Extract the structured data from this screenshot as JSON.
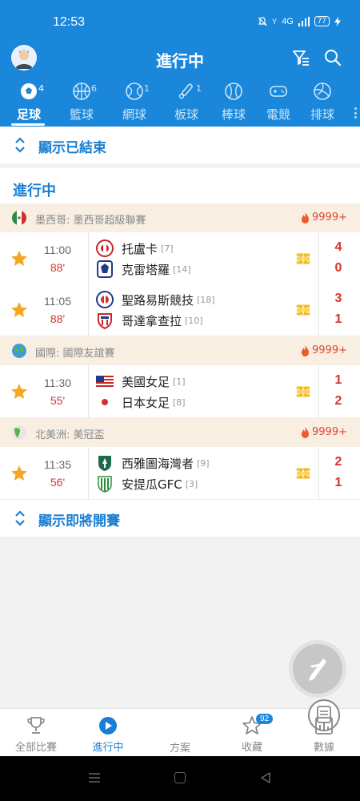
{
  "status": {
    "time": "12:53",
    "network": "4G",
    "battery": "77"
  },
  "header": {
    "title": "進行中"
  },
  "tabs": [
    {
      "label": "足球",
      "count": "4",
      "icon": "soccer-ball-icon",
      "active": true
    },
    {
      "label": "籃球",
      "count": "6",
      "icon": "basketball-icon"
    },
    {
      "label": "網球",
      "count": "1",
      "icon": "tennis-ball-icon"
    },
    {
      "label": "板球",
      "count": "1",
      "icon": "cricket-bat-icon"
    },
    {
      "label": "棒球",
      "count": "",
      "icon": "baseball-icon"
    },
    {
      "label": "電競",
      "count": "",
      "icon": "gamepad-icon"
    },
    {
      "label": "排球",
      "count": "",
      "icon": "volleyball-icon"
    }
  ],
  "show_finished": "顯示已結束",
  "section_title": "進行中",
  "leagues": [
    {
      "name": "墨西哥: 墨西哥超級聯賽",
      "hot": "9999+",
      "flag": "mexico-flag-icon",
      "matches": [
        {
          "time": "11:00",
          "minute": "88'",
          "home": "托盧卡",
          "home_rank": "[7]",
          "away": "克雷塔羅",
          "away_rank": "[14]",
          "home_score": "4",
          "away_score": "0"
        },
        {
          "time": "11:05",
          "minute": "88'",
          "home": "聖路易斯競技",
          "home_rank": "[18]",
          "away": "哥達拿查拉",
          "away_rank": "[10]",
          "home_score": "3",
          "away_score": "1"
        }
      ]
    },
    {
      "name": "國際: 國際友誼賽",
      "hot": "9999+",
      "flag": "globe-icon",
      "matches": [
        {
          "time": "11:30",
          "minute": "55'",
          "home": "美國女足",
          "home_rank": "[1]",
          "away": "日本女足",
          "away_rank": "[8]",
          "home_score": "1",
          "away_score": "2"
        }
      ]
    },
    {
      "name": "北美洲: 美冠盃",
      "hot": "9999+",
      "flag": "north-america-globe-icon",
      "matches": [
        {
          "time": "11:35",
          "minute": "56'",
          "home": "西雅圖海灣者",
          "home_rank": "[9]",
          "away": "安提瓜GFC",
          "away_rank": "[3]",
          "home_score": "2",
          "away_score": "1"
        }
      ]
    }
  ],
  "show_upcoming": "顯示即將開賽",
  "bottom_nav": [
    {
      "label": "全部比賽",
      "icon": "trophy-icon"
    },
    {
      "label": "進行中",
      "icon": "play-circle-icon",
      "active": true
    },
    {
      "label": "方案",
      "icon": "document-icon"
    },
    {
      "label": "收藏",
      "icon": "star-icon",
      "badge": "92"
    },
    {
      "label": "數據",
      "icon": "bar-chart-icon"
    }
  ],
  "colors": {
    "primary": "#1a87db",
    "accent_red": "#d8322a",
    "star": "#f5a623",
    "league_bg": "#f8efe2"
  }
}
